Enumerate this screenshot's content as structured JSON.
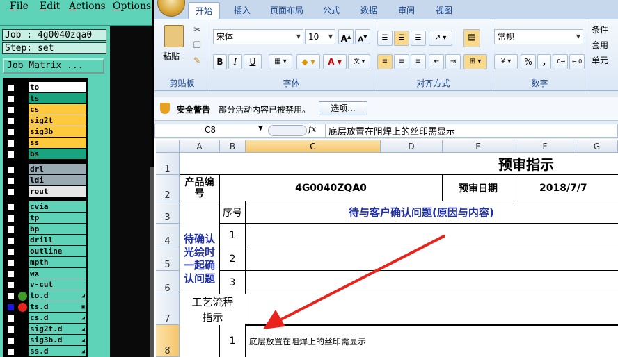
{
  "cam": {
    "menu": [
      "File",
      "Edit",
      "Actions",
      "Options"
    ],
    "job_label": "Job : 4g0040zqa0",
    "step_label": "Step: set",
    "job_matrix": "Job Matrix ...",
    "layers": [
      {
        "name": "to",
        "color": "#ffffff",
        "dot": "",
        "sel": false,
        "mark": ""
      },
      {
        "name": "ts",
        "color": "#1aa37f",
        "dot": "",
        "sel": false,
        "mark": ""
      },
      {
        "name": "cs",
        "color": "#ffc93c",
        "dot": "",
        "sel": false,
        "mark": ""
      },
      {
        "name": "sig2t",
        "color": "#ffc93c",
        "dot": "",
        "sel": false,
        "mark": ""
      },
      {
        "name": "sig3b",
        "color": "#ffc93c",
        "dot": "",
        "sel": false,
        "mark": ""
      },
      {
        "name": "ss",
        "color": "#ffc93c",
        "dot": "",
        "sel": false,
        "mark": ""
      },
      {
        "name": "bs",
        "color": "#1aa37f",
        "dot": "",
        "sel": false,
        "mark": ""
      },
      {
        "name": "drl",
        "color": "#9aaab3",
        "dot": "",
        "sel": false,
        "mark": ""
      },
      {
        "name": "ldi",
        "color": "#9aaab3",
        "dot": "",
        "sel": false,
        "mark": ""
      },
      {
        "name": "rout",
        "color": "#e6e6e6",
        "dot": "",
        "sel": false,
        "mark": ""
      },
      {
        "name": "cvia",
        "color": "#5fd3b8",
        "dot": "",
        "sel": false,
        "mark": ""
      },
      {
        "name": "tp",
        "color": "#5fd3b8",
        "dot": "",
        "sel": false,
        "mark": ""
      },
      {
        "name": "bp",
        "color": "#5fd3b8",
        "dot": "",
        "sel": false,
        "mark": ""
      },
      {
        "name": "drill",
        "color": "#5fd3b8",
        "dot": "",
        "sel": false,
        "mark": ""
      },
      {
        "name": "outline",
        "color": "#5fd3b8",
        "dot": "",
        "sel": false,
        "mark": ""
      },
      {
        "name": "mpth",
        "color": "#5fd3b8",
        "dot": "",
        "sel": false,
        "mark": ""
      },
      {
        "name": "wx",
        "color": "#5fd3b8",
        "dot": "",
        "sel": false,
        "mark": ""
      },
      {
        "name": "v-cut",
        "color": "#5fd3b8",
        "dot": "",
        "sel": false,
        "mark": ""
      },
      {
        "name": "to.d",
        "color": "#5fd3b8",
        "dot": "#3f9a2a",
        "sel": false,
        "mark": "◢"
      },
      {
        "name": "ts.d",
        "color": "#5fd3b8",
        "dot": "#e8231c",
        "sel": true,
        "mark": "▣"
      },
      {
        "name": "cs.d",
        "color": "#5fd3b8",
        "dot": "",
        "sel": false,
        "mark": "◢"
      },
      {
        "name": "sig2t.d",
        "color": "#5fd3b8",
        "dot": "",
        "sel": false,
        "mark": "◢"
      },
      {
        "name": "sig3b.d",
        "color": "#5fd3b8",
        "dot": "",
        "sel": false,
        "mark": "◢"
      },
      {
        "name": "ss.d",
        "color": "#5fd3b8",
        "dot": "",
        "sel": false,
        "mark": "◢"
      }
    ]
  },
  "excel": {
    "tabs": [
      "开始",
      "插入",
      "页面布局",
      "公式",
      "数据",
      "审阅",
      "视图"
    ],
    "clipboard": {
      "paste": "粘贴",
      "label": "剪贴板"
    },
    "font": {
      "name": "宋体",
      "size": "10",
      "label": "字体"
    },
    "alignment": {
      "label": "对齐方式"
    },
    "number": {
      "format": "常规",
      "label": "数字",
      "percent": "%",
      "comma": ","
    },
    "right_group": [
      "条件",
      "套用",
      "单元"
    ],
    "security": {
      "title": "安全警告",
      "message": "部分活动内容已被禁用。",
      "options": "选项..."
    },
    "formula_bar": {
      "name_box": "C8",
      "fx": "fx",
      "content": "底层放置在阻焊上的丝印需显示"
    },
    "columns": [
      "A",
      "B",
      "C",
      "D",
      "E",
      "F",
      "G"
    ],
    "rows": [
      "1",
      "2",
      "3",
      "4",
      "5",
      "6",
      "7",
      "8"
    ],
    "sheet": {
      "title": "预审指示",
      "product_label": "产品编号",
      "product_value": "4G0040ZQA0",
      "date_label": "预审日期",
      "date_value": "2018/7/7",
      "seq_header": "序号",
      "issue_header": "待与客户确认问题(原因与内容)",
      "confirm_label": "待确认光绘时一起确认问题",
      "seq": [
        "1",
        "2",
        "3"
      ],
      "process_label": "工艺流程指示",
      "row8_seq": "1",
      "row8_text": "底层放置在阻焊上的丝印需显示"
    }
  }
}
